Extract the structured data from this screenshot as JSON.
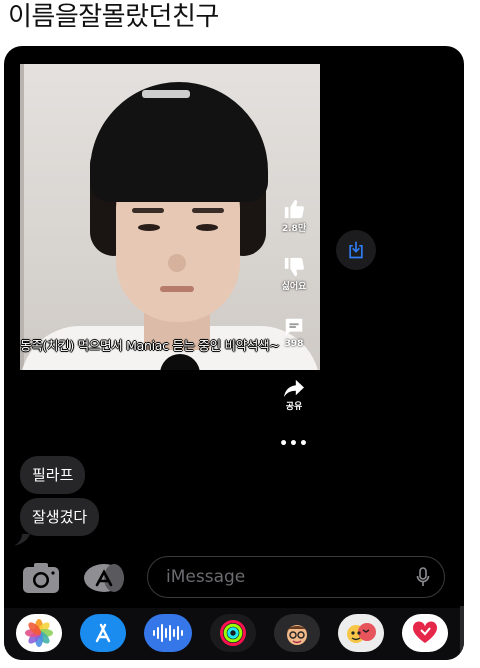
{
  "caption": "이름을잘몰랐던친구",
  "video": {
    "subtitle": "동족(치킨) 먹으면서 Maniac 듣는 중인 비약석색~",
    "like_count": "2.8만",
    "dislike_label": "싫어요",
    "comment_count": "398",
    "share_label": "공유",
    "more_label": "•••"
  },
  "messages": [
    {
      "text": "필라프"
    },
    {
      "text": "잘생겼다"
    }
  ],
  "compose": {
    "placeholder": "iMessage"
  },
  "app_drawer": {
    "apps": [
      {
        "name": "photos-app-icon"
      },
      {
        "name": "app-store-icon"
      },
      {
        "name": "audio-message-icon"
      },
      {
        "name": "activity-rings-icon"
      },
      {
        "name": "memoji-icon"
      },
      {
        "name": "memoji-stickers-icon"
      },
      {
        "name": "digital-touch-icon"
      }
    ]
  },
  "colors": {
    "background": "#000000",
    "bubble": "#262628",
    "accent_blue": "#2f7cf6"
  }
}
